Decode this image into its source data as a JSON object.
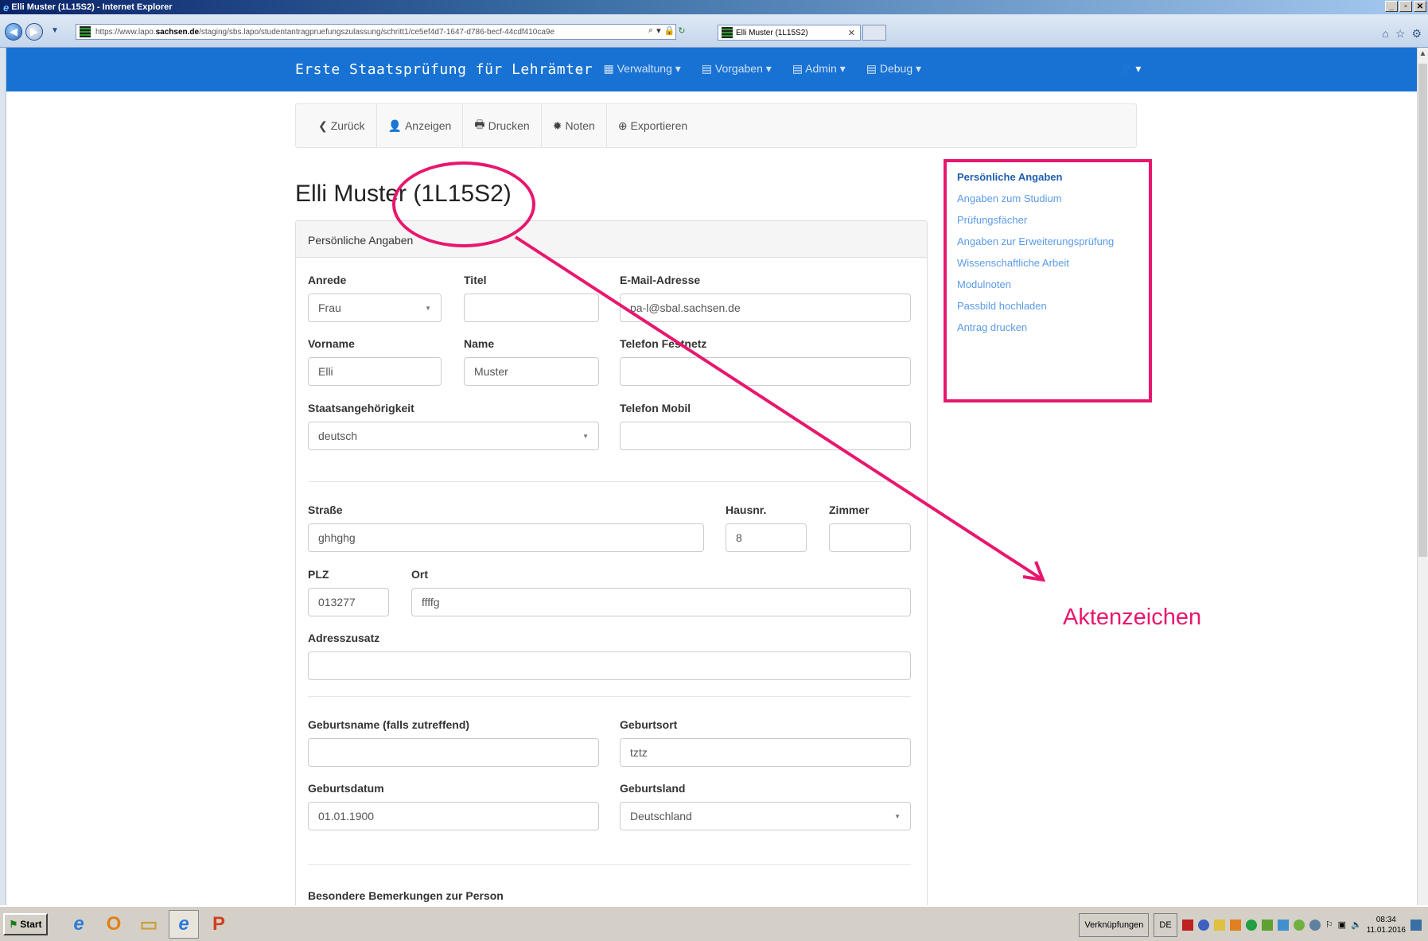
{
  "window": {
    "title": "Elli Muster (1L15S2) - Internet Explorer",
    "url_prefix": "https://www.lapo.",
    "url_domain": "sachsen.de",
    "url_rest": "/staging/sbs.lapo/studentantragpruefungszulassung/schritt1/ce5ef4d7-1647-d786-becf-44cdf410ca9e",
    "tab_title": "Elli Muster (1L15S2)"
  },
  "navbar": {
    "brand": "Erste Staatsprüfung für Lehrämter",
    "items": [
      "Verwaltung ▾",
      "Vorgaben ▾",
      "Admin ▾",
      "Debug ▾"
    ]
  },
  "toolbar": {
    "back": "Zurück",
    "show": "Anzeigen",
    "print": "Drucken",
    "grades": "Noten",
    "export": "Exportieren"
  },
  "page": {
    "title": "Elli Muster (1L15S2)",
    "panel_title": "Persönliche Angaben"
  },
  "form": {
    "anrede": {
      "label": "Anrede",
      "value": "Frau"
    },
    "titel": {
      "label": "Titel",
      "value": ""
    },
    "email": {
      "label": "E-Mail-Adresse",
      "value": "pa-l@sbal.sachsen.de"
    },
    "vorname": {
      "label": "Vorname",
      "value": "Elli"
    },
    "name": {
      "label": "Name",
      "value": "Muster"
    },
    "telefon_festnetz": {
      "label": "Telefon Festnetz",
      "value": ""
    },
    "staatsangehoerigkeit": {
      "label": "Staatsangehörigkeit",
      "value": "deutsch"
    },
    "telefon_mobil": {
      "label": "Telefon Mobil",
      "value": ""
    },
    "strasse": {
      "label": "Straße",
      "value": "ghhghg"
    },
    "hausnr": {
      "label": "Hausnr.",
      "value": "8"
    },
    "zimmer": {
      "label": "Zimmer",
      "value": ""
    },
    "plz": {
      "label": "PLZ",
      "value": "013277"
    },
    "ort": {
      "label": "Ort",
      "value": "ffffg"
    },
    "adresszusatz": {
      "label": "Adresszusatz",
      "value": ""
    },
    "geburtsname": {
      "label": "Geburtsname (falls zutreffend)",
      "value": ""
    },
    "geburtsort": {
      "label": "Geburtsort",
      "value": "tztz"
    },
    "geburtsdatum": {
      "label": "Geburtsdatum",
      "value": "01.01.1900"
    },
    "geburtsland": {
      "label": "Geburtsland",
      "value": "Deutschland"
    },
    "bemerkungen": {
      "label": "Besondere Bemerkungen zur Person"
    }
  },
  "sidenav": [
    "Persönliche Angaben",
    "Angaben zum Studium",
    "Prüfungsfächer",
    "Angaben zur Erweiterungsprüfung",
    "Wissenschaftliche Arbeit",
    "Modulnoten",
    "Passbild hochladen",
    "Antrag drucken"
  ],
  "annotation": {
    "label": "Aktenzeichen",
    "color": "#e8176e"
  },
  "taskbar": {
    "start": "Start",
    "links": "Verknüpfungen",
    "lang": "DE",
    "time": "08:34",
    "date": "11.01.2016"
  },
  "colors": {
    "navbar": "#1872d3",
    "link": "#5b9be8",
    "active_link": "#1f5fae",
    "annotation": "#e8176e"
  }
}
